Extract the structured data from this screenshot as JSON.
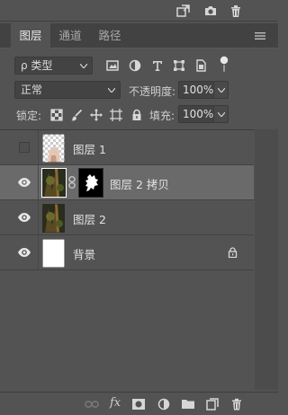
{
  "panel": {
    "tabs": [
      {
        "label": "图层",
        "active": true
      },
      {
        "label": "通道",
        "active": false
      },
      {
        "label": "路径",
        "active": false
      }
    ]
  },
  "filter": {
    "kind_label": "ρ 类型"
  },
  "blend": {
    "mode": "正常",
    "opacity_label": "不透明度:",
    "opacity_value": "100%"
  },
  "lock": {
    "label": "锁定:",
    "fill_label": "填充:",
    "fill_value": "100%"
  },
  "layers": [
    {
      "name": "图层 1",
      "visible": false,
      "selected": false,
      "has_mask": false
    },
    {
      "name": "图层 2 拷贝",
      "visible": true,
      "selected": true,
      "has_mask": true
    },
    {
      "name": "图层 2",
      "visible": true,
      "selected": false,
      "has_mask": false
    },
    {
      "name": "背景",
      "visible": true,
      "selected": false,
      "has_mask": false,
      "locked": true
    }
  ],
  "bottom": {
    "fx_label": "fx"
  },
  "colors": {
    "panel_bg": "#535353",
    "selected_row": "#6a6a6a",
    "tab_bar": "#424242"
  }
}
